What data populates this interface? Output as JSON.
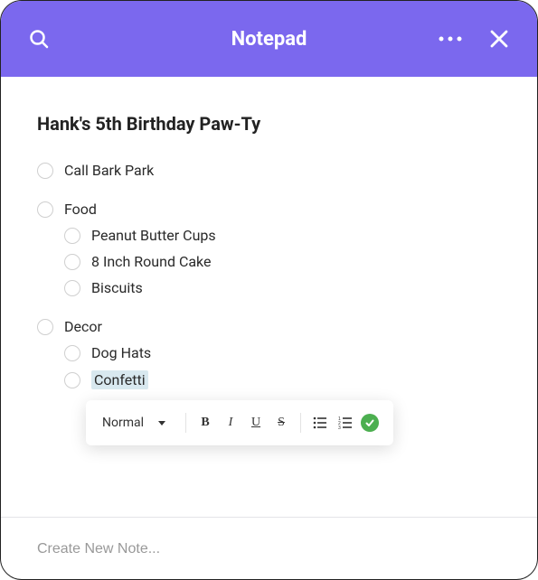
{
  "header": {
    "title": "Notepad"
  },
  "note": {
    "title": "Hank's 5th Birthday Paw-Ty",
    "items": [
      {
        "label": "Call Bark Park"
      },
      {
        "label": "Food",
        "children": [
          {
            "label": "Peanut Butter Cups"
          },
          {
            "label": "8 Inch Round Cake"
          },
          {
            "label": "Biscuits"
          }
        ]
      },
      {
        "label": "Decor",
        "children": [
          {
            "label": "Dog Hats"
          },
          {
            "label": "Confetti",
            "highlighted": true
          }
        ]
      }
    ]
  },
  "toolbar": {
    "format": "Normal",
    "bold": "B",
    "italic": "I",
    "underline": "U",
    "strike": "S"
  },
  "footer": {
    "placeholder": "Create New Note..."
  }
}
